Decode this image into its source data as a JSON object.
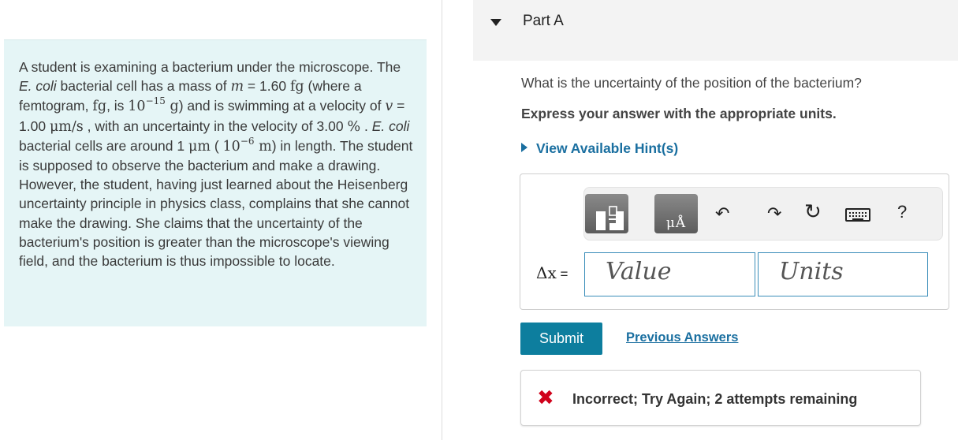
{
  "problem": {
    "s1": "A student is examining a bacterium under the microscope. The ",
    "ecoli": "E. coli",
    "s2": " bacterial cell has a mass of ",
    "m": "m",
    "eq": " = ",
    "mass_value": "1.60",
    "fg": "fg",
    "s3": " (where a femtogram, ",
    "s4": ", is ",
    "ten": "10",
    "exp15": "−15",
    "g": "g",
    "s5": ") and is swimming at a velocity of ",
    "v": "v",
    "speed_value": "1.00",
    "speed_unit": "μm/s",
    "s6": " , with an uncertainty in the velocity of ",
    "pct_value": "3.00",
    "pct": "%",
    "s7": " . ",
    "s8": " bacterial cells are around ",
    "len_value": "1",
    "um": "μm",
    "paren_open": " ( ",
    "exp6": "−6",
    "unit_m": "m",
    "s9": ") in length. The student is supposed to observe the bacterium and make a drawing. However, the student, having just learned about the Heisenberg uncertainty principle in physics class, complains that she cannot make the drawing. She claims that the uncertainty of the bacterium's position is greater than the microscope's viewing field, and the bacterium is thus impossible to locate."
  },
  "part": {
    "title": "Part A"
  },
  "question": "What is the uncertainty of the position of the bacterium?",
  "instruction": "Express your answer with the appropriate units.",
  "hint_label": "View Available Hint(s)",
  "toolbar": {
    "units_glyph": "μÅ",
    "undo": "↶",
    "redo": "↷",
    "reset": "↻",
    "help": "?",
    "icons": [
      "templates-icon",
      "units-icon",
      "undo-icon",
      "redo-icon",
      "reset-icon",
      "keyboard-icon",
      "help-icon"
    ]
  },
  "answer": {
    "delta_label": "Δx",
    "equals": " =",
    "value_placeholder": "Value",
    "units_placeholder": "Units"
  },
  "submit_label": "Submit",
  "previous_answers_label": "Previous Answers",
  "feedback": {
    "icon": "✖",
    "text": "Incorrect; Try Again; 2 attempts remaining"
  },
  "colors": {
    "problem_bg": "#e5f5f6",
    "link": "#1a6fa0",
    "submit_bg": "#0d7e9e",
    "input_border": "#3a8db9",
    "incorrect": "#d0021b"
  }
}
